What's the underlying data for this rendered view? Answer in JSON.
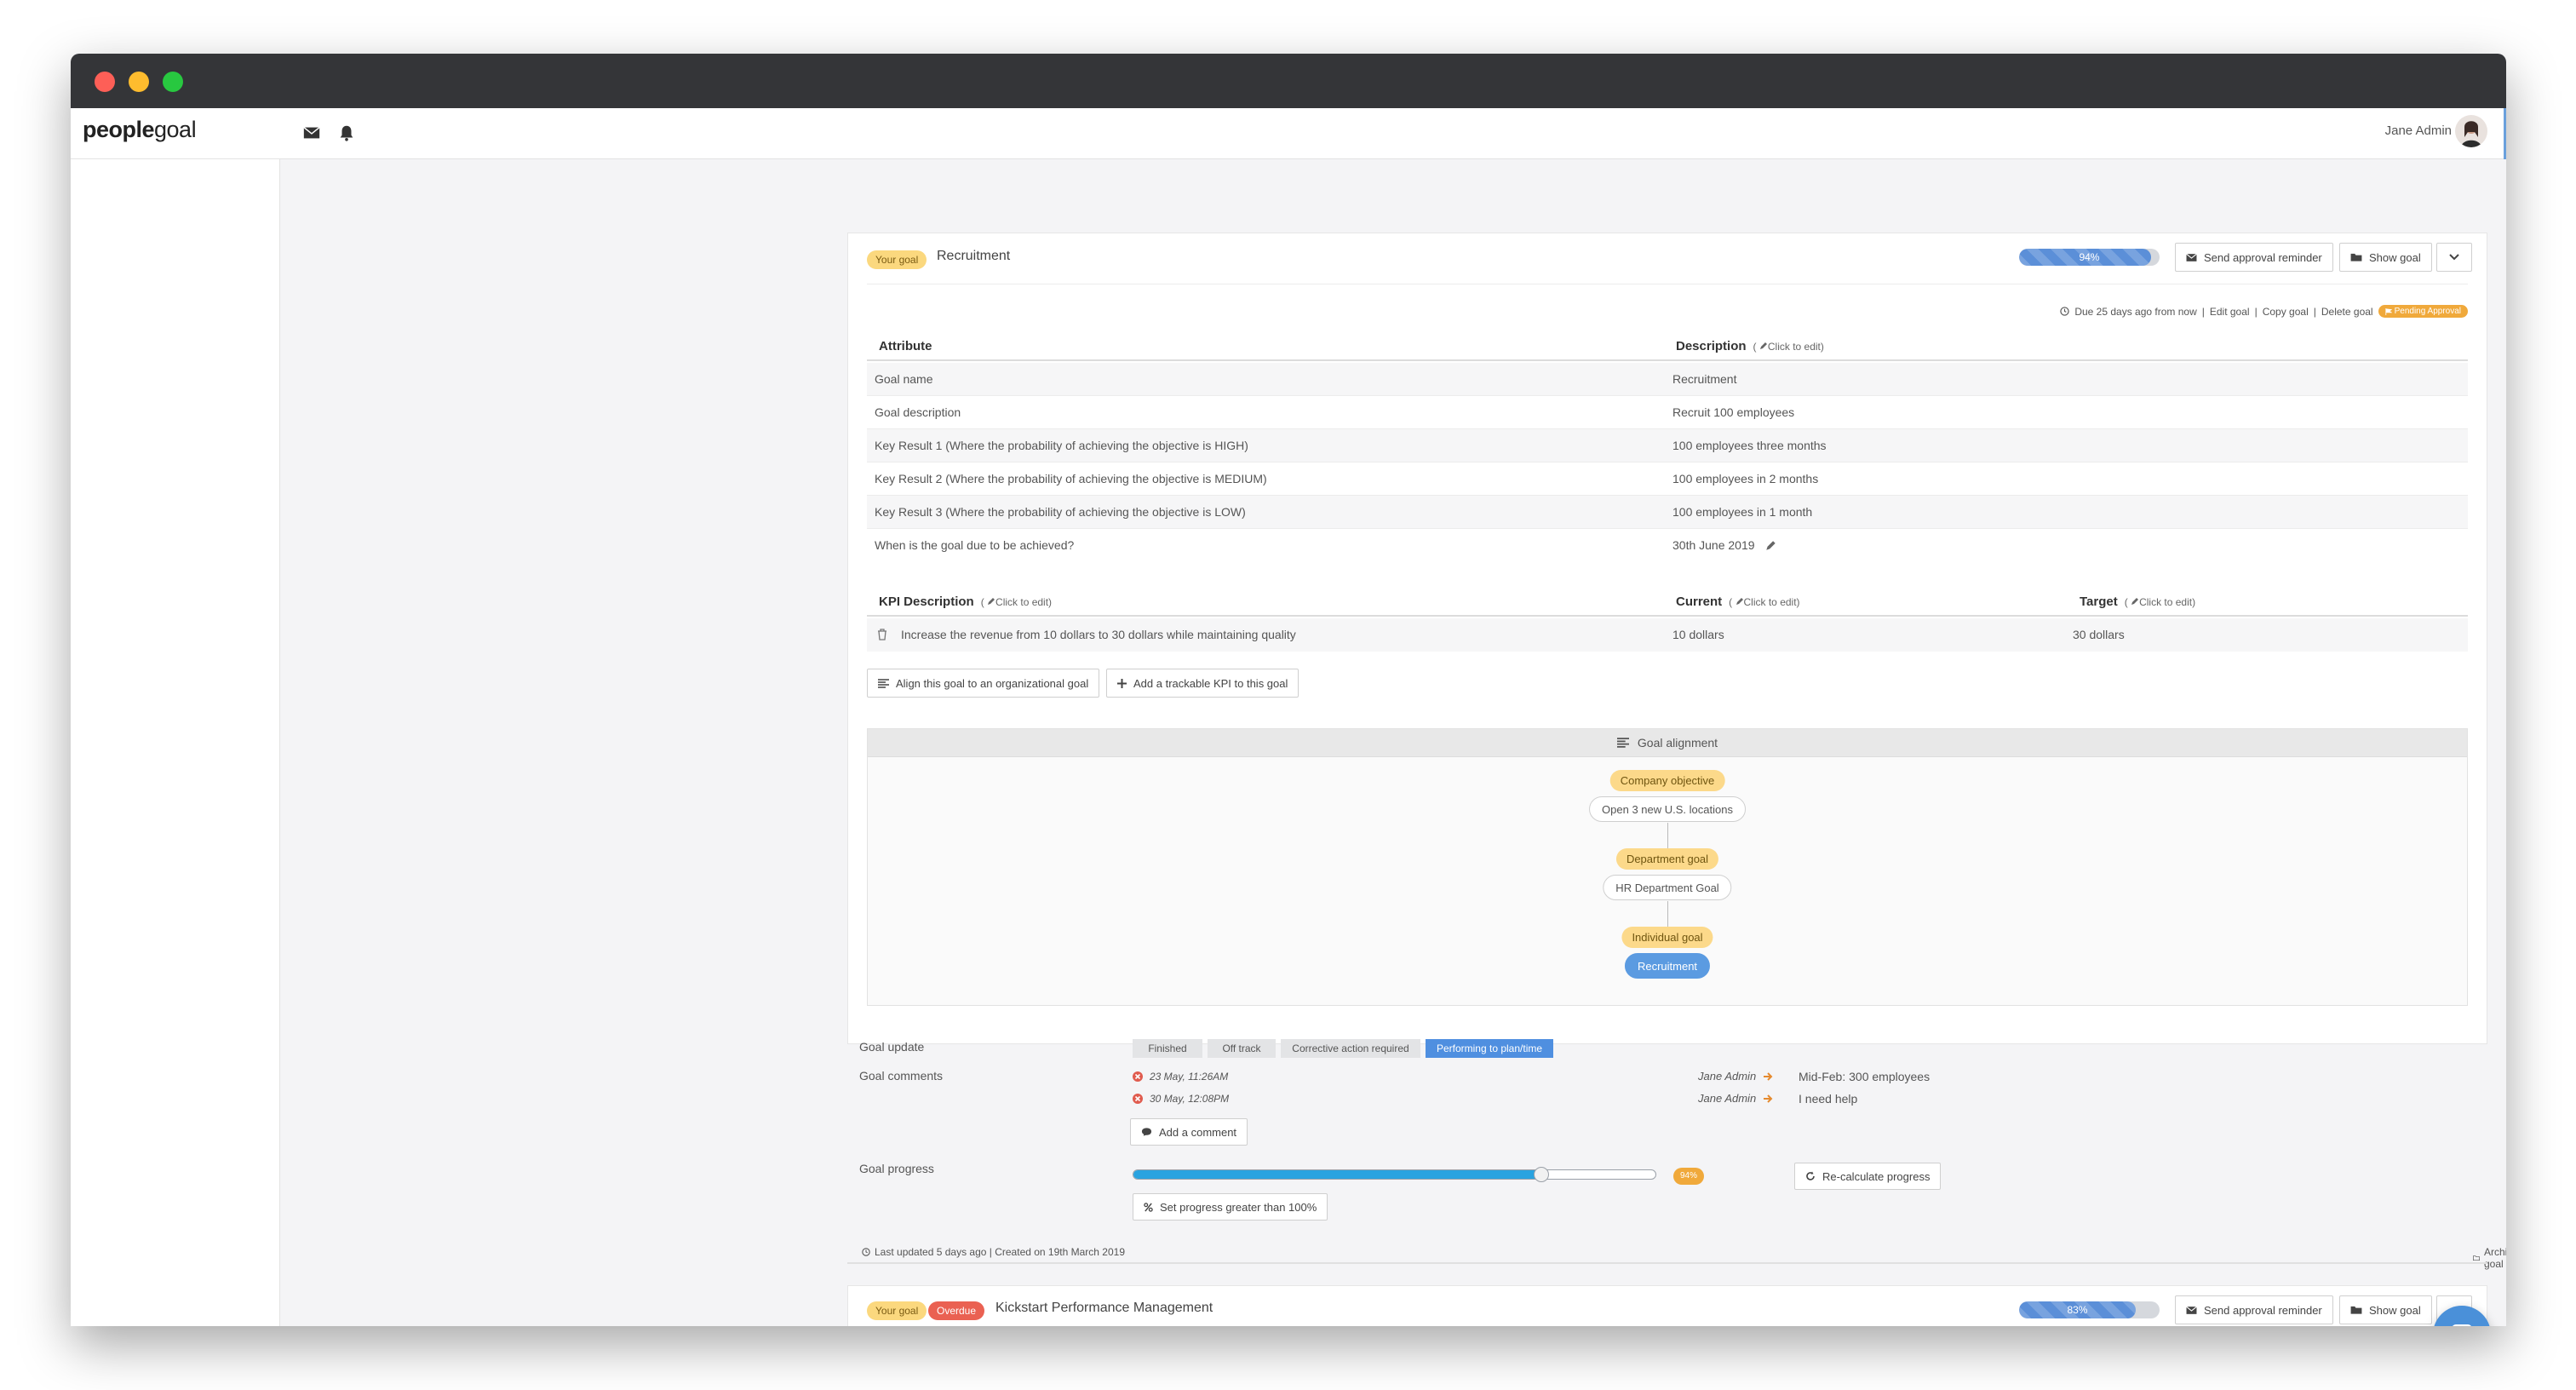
{
  "app": {
    "logo_bold": "people",
    "logo_light": "goal",
    "user_name": "Jane Admin"
  },
  "goal1": {
    "badge": "Your goal",
    "title": "Recruitment",
    "progress": {
      "value": 94,
      "label": "94%"
    },
    "buttons": {
      "send_reminder": "Send approval reminder",
      "show_goal": "Show goal"
    },
    "meta": {
      "due": "Due 25 days ago from now",
      "edit": "Edit goal",
      "copy": "Copy goal",
      "delete": "Delete goal",
      "status": "Pending Approval",
      "sep": "|"
    },
    "table": {
      "header_attribute": "Attribute",
      "header_description": "Description",
      "click_to_edit": "Click to edit)",
      "paren_open": "(",
      "rows": [
        {
          "attribute": "Goal name",
          "value": "Recruitment"
        },
        {
          "attribute": "Goal description",
          "value": "Recruit 100 employees"
        },
        {
          "attribute": "Key Result 1 (Where the probability of achieving the objective is HIGH)",
          "value": "100 employees three months"
        },
        {
          "attribute": "Key Result 2 (Where the probability of achieving the objective is MEDIUM)",
          "value": "100 employees in 2 months"
        },
        {
          "attribute": "Key Result 3 (Where the probability of achieving the objective is LOW)",
          "value": "100 employees in 1 month"
        },
        {
          "attribute": "When is the goal due to be achieved?",
          "value": "30th June 2019"
        }
      ]
    },
    "kpi": {
      "header_description": "KPI Description",
      "header_current": "Current",
      "header_target": "Target",
      "rows": [
        {
          "description": "Increase the revenue from 10 dollars to 30 dollars while maintaining quality",
          "current": "10 dollars",
          "target": "30 dollars"
        }
      ]
    },
    "actions": {
      "align": "Align this goal to an organizational goal",
      "add_kpi": "Add a trackable KPI to this goal"
    },
    "alignment": {
      "title": "Goal alignment",
      "nodes": [
        {
          "type": "Company objective",
          "name": "Open 3 new U.S. locations"
        },
        {
          "type": "Department goal",
          "name": "HR Department Goal"
        },
        {
          "type": "Individual goal",
          "name": "Recruitment"
        }
      ]
    },
    "update": {
      "label": "Goal update",
      "statuses": [
        "Finished",
        "Off track",
        "Corrective action required",
        "Performing to plan/time"
      ],
      "selected": "Performing to plan/time"
    },
    "comments": {
      "label": "Goal comments",
      "items": [
        {
          "date": "23 May, 11:26AM",
          "user": "Jane Admin",
          "text": "Mid-Feb: 300 employees"
        },
        {
          "date": "30 May, 12:08PM",
          "user": "Jane Admin",
          "text": "I need help"
        }
      ],
      "add_button": "Add a comment"
    },
    "goal_progress": {
      "label": "Goal progress",
      "value": 78,
      "badge": "94%",
      "recalc_button": "Re-calculate progress",
      "over100_button": "Set progress greater than 100%"
    },
    "footer": {
      "updated": "Last updated 5 days ago | Created on 19th March 2019",
      "archive": "Archive goal"
    }
  },
  "goal2": {
    "badge": "Your goal",
    "overdue": "Overdue",
    "title": "Kickstart Performance Management",
    "progress": {
      "value": 83,
      "label": "83%"
    },
    "buttons": {
      "send_reminder": "Send approval reminder",
      "show_goal": "Show goal"
    }
  },
  "colors": {
    "accent": "#5b8fd8",
    "badge_yellow": "#fbd87e",
    "overdue_red": "#ea6152",
    "status_orange": "#f0a93b"
  },
  "icons": [
    "envelope-icon",
    "bell-icon",
    "pencil-icon",
    "clock-icon",
    "flag-icon",
    "trash-icon",
    "align-icon",
    "plus-icon",
    "folder-icon",
    "chevron-down-icon",
    "comment-icon",
    "refresh-icon",
    "percent-icon",
    "close-circle-icon",
    "arrow-right-icon",
    "chat-icon"
  ]
}
